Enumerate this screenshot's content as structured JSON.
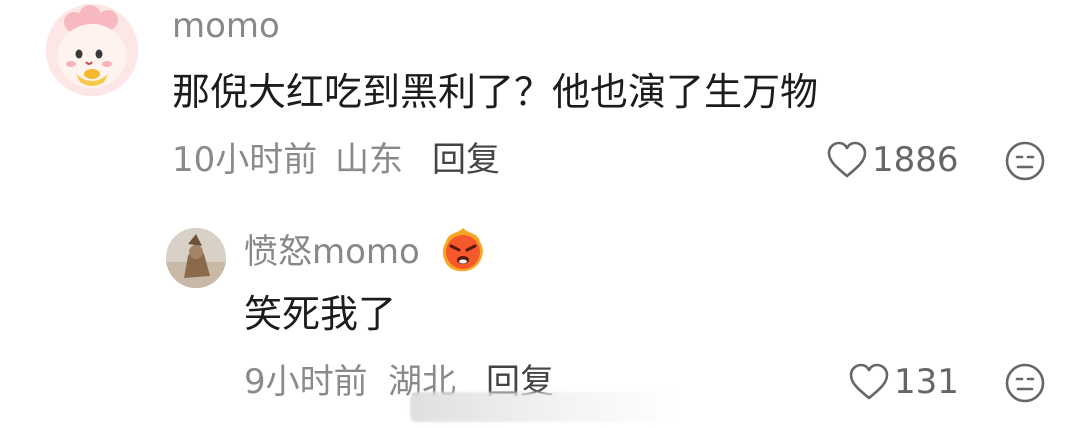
{
  "comment": {
    "username": "momo",
    "text": "那倪大红吃到黑利了？他也演了生万物",
    "time": "10小时前",
    "location": "山东",
    "reply_label": "回复",
    "like_count": "1886"
  },
  "reply": {
    "username": "愤怒momo",
    "text": "笑死我了",
    "time": "9小时前",
    "location": "湖北",
    "reply_label": "回复",
    "like_count": "131"
  },
  "icons": {
    "like": "heart-outline-icon",
    "emoji": "neutral-face-icon",
    "badge": "angry-emoji-icon"
  },
  "colors": {
    "username": "#888888",
    "content": "#1c1c1c",
    "meta": "#8a8a8a",
    "badge": "#f5582a"
  }
}
